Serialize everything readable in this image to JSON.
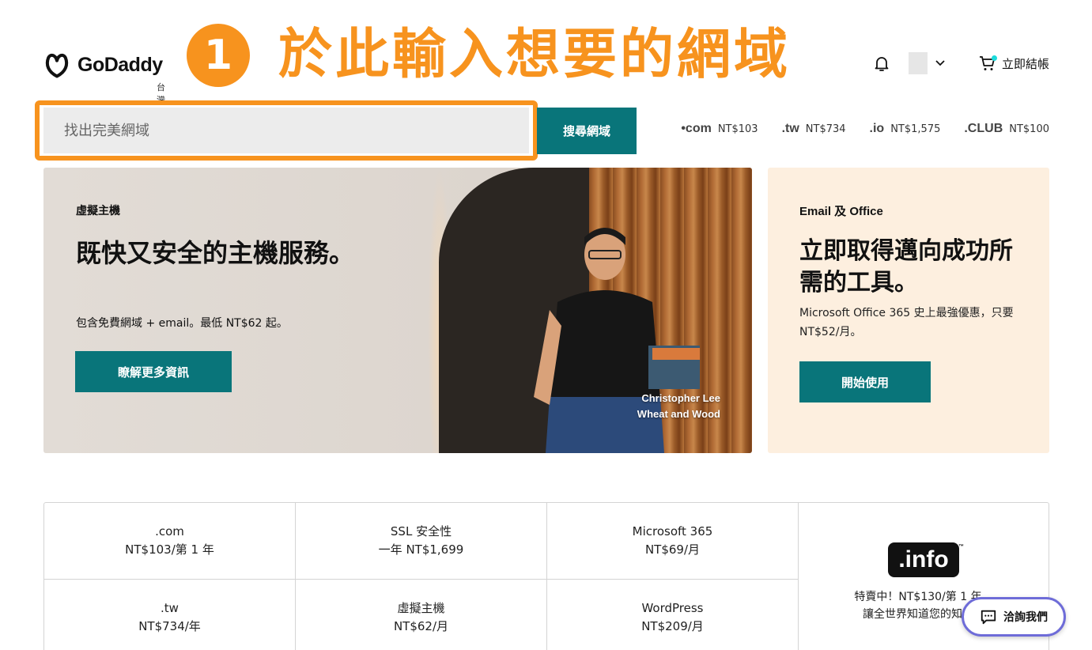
{
  "header": {
    "logo_text": "GoDaddy",
    "logo_sub": "台灣",
    "annotation_number": "1",
    "annotation_text": "於此輸入想要的網域",
    "checkout_label": "立即結帳"
  },
  "search": {
    "placeholder": "找出完美網域",
    "button_label": "搜尋網域"
  },
  "tld_offers": [
    {
      "logo": "•com",
      "price": "NT$103"
    },
    {
      "logo": ".tw",
      "price": "NT$734"
    },
    {
      "logo": ".io",
      "price": "NT$1,575"
    },
    {
      "logo": ".CLUB",
      "price": "NT$100"
    }
  ],
  "hero": {
    "category": "虛擬主機",
    "title": "既快又安全的主機服務。",
    "subtitle": "包含免費網域 + email。最低 NT$62 起。",
    "button_label": "瞭解更多資訊",
    "caption_line1": "Christopher Lee",
    "caption_line2": "Wheat and Wood"
  },
  "email_card": {
    "category": "Email 及 Office",
    "title": "立即取得邁向成功所需的工具。",
    "subtitle": "Microsoft Office 365 史上最強優惠，只要 NT$52/月。",
    "button_label": "開始使用"
  },
  "products": [
    {
      "name": ".com",
      "price": "NT$103/第 1 年"
    },
    {
      "name": "SSL 安全性",
      "price": "一年 NT$1,699"
    },
    {
      "name": "Microsoft 365",
      "price": "NT$69/月"
    },
    {
      "name": ".tw",
      "price": "NT$734/年"
    },
    {
      "name": "虛擬主機",
      "price": "NT$62/月"
    },
    {
      "name": "WordPress",
      "price": "NT$209/月"
    }
  ],
  "info_promo": {
    "logo": ".info",
    "line1": "特賣中！NT$130/第 1 年。",
    "line2": "讓全世界知道您的知識。"
  },
  "chat": {
    "label": "洽詢我們"
  },
  "colors": {
    "accent_teal": "#09757a",
    "annotation_orange": "#f7931e",
    "chat_border": "#6e6cd8"
  }
}
